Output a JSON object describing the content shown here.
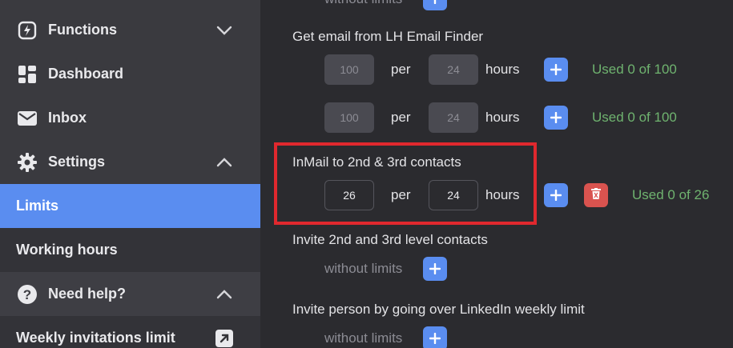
{
  "sidebar": {
    "functions": "Functions",
    "dashboard": "Dashboard",
    "inbox": "Inbox",
    "settings": "Settings",
    "limits": "Limits",
    "working_hours": "Working hours",
    "need_help": "Need help?",
    "weekly_invitations": "Weekly invitations limit"
  },
  "main": {
    "top_cut_text": "without limits",
    "email_finder": {
      "title": "Get email from LH Email Finder",
      "rows": [
        {
          "count": "100",
          "per": "per",
          "hours_value": "24",
          "hours": "hours",
          "used": "Used 0 of 100"
        },
        {
          "count": "100",
          "per": "per",
          "hours_value": "24",
          "hours": "hours",
          "used": "Used 0 of 100"
        }
      ]
    },
    "inmail": {
      "title": "InMail to 2nd & 3rd contacts",
      "count": "26",
      "per": "per",
      "hours_value": "24",
      "hours": "hours",
      "used": "Used 0 of 26"
    },
    "invite_2nd_3rd": {
      "title": "Invite 2nd and 3rd level contacts",
      "limit": "without limits"
    },
    "invite_weekly": {
      "title": "Invite person by going over LinkedIn weekly limit",
      "limit": "without limits"
    }
  },
  "colors": {
    "accent": "#5a8df0",
    "danger": "#d9534f",
    "used_green": "#6fb36f",
    "highlight_red": "#e0282e"
  }
}
